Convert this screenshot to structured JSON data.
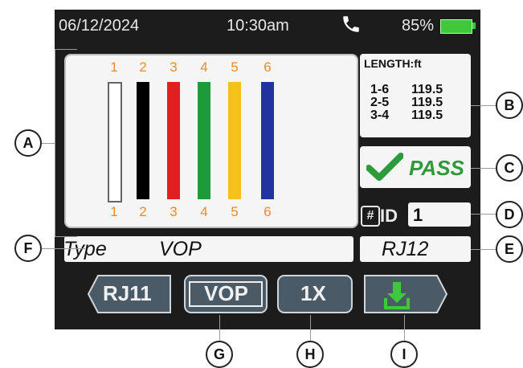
{
  "status": {
    "date": "06/12/2024",
    "time": "10:30am",
    "battery_pct": "85%",
    "phone_icon": "phone-icon",
    "battery_color": "#3fc83b"
  },
  "wires": {
    "top_pins": [
      "1",
      "2",
      "3",
      "4",
      "5",
      "6"
    ],
    "bottom_pins": [
      "1",
      "2",
      "3",
      "4",
      "5",
      "6"
    ],
    "colors": [
      "#ffffff",
      "#000000",
      "#e02020",
      "#1f9a3a",
      "#f4c21a",
      "#2233a0"
    ]
  },
  "length": {
    "title": "LENGTH:ft",
    "rows": [
      {
        "pair": "1-6",
        "value": "119.5"
      },
      {
        "pair": "2-5",
        "value": "119.5"
      },
      {
        "pair": "3-4",
        "value": "119.5"
      }
    ]
  },
  "result": {
    "label": "PASS",
    "color": "#2e9a3a"
  },
  "id": {
    "hash": "#",
    "label": "ID",
    "value": "1"
  },
  "info": {
    "type_label": "Type",
    "vop_label": "VOP",
    "connector": "RJ12"
  },
  "softkeys": [
    {
      "label": "RJ11"
    },
    {
      "label": "VOP"
    },
    {
      "label": "1X"
    },
    {
      "label": "",
      "icon": "download-icon"
    }
  ],
  "callouts": [
    "A",
    "B",
    "C",
    "D",
    "E",
    "F",
    "G",
    "H",
    "I"
  ]
}
